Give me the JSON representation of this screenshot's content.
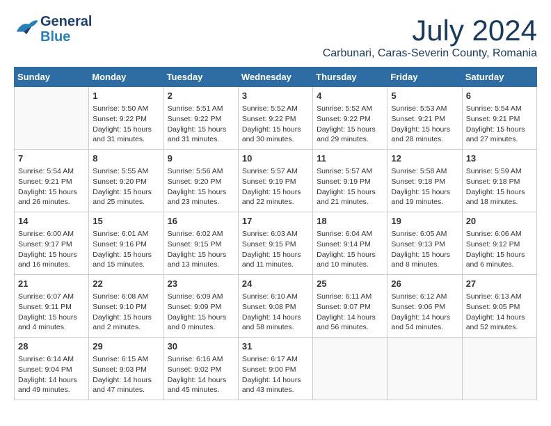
{
  "header": {
    "logo_general": "General",
    "logo_blue": "Blue",
    "month": "July 2024",
    "location": "Carbunari, Caras-Severin County, Romania"
  },
  "weekdays": [
    "Sunday",
    "Monday",
    "Tuesday",
    "Wednesday",
    "Thursday",
    "Friday",
    "Saturday"
  ],
  "weeks": [
    [
      {
        "day": "",
        "content": ""
      },
      {
        "day": "1",
        "content": "Sunrise: 5:50 AM\nSunset: 9:22 PM\nDaylight: 15 hours\nand 31 minutes."
      },
      {
        "day": "2",
        "content": "Sunrise: 5:51 AM\nSunset: 9:22 PM\nDaylight: 15 hours\nand 31 minutes."
      },
      {
        "day": "3",
        "content": "Sunrise: 5:52 AM\nSunset: 9:22 PM\nDaylight: 15 hours\nand 30 minutes."
      },
      {
        "day": "4",
        "content": "Sunrise: 5:52 AM\nSunset: 9:22 PM\nDaylight: 15 hours\nand 29 minutes."
      },
      {
        "day": "5",
        "content": "Sunrise: 5:53 AM\nSunset: 9:21 PM\nDaylight: 15 hours\nand 28 minutes."
      },
      {
        "day": "6",
        "content": "Sunrise: 5:54 AM\nSunset: 9:21 PM\nDaylight: 15 hours\nand 27 minutes."
      }
    ],
    [
      {
        "day": "7",
        "content": "Sunrise: 5:54 AM\nSunset: 9:21 PM\nDaylight: 15 hours\nand 26 minutes."
      },
      {
        "day": "8",
        "content": "Sunrise: 5:55 AM\nSunset: 9:20 PM\nDaylight: 15 hours\nand 25 minutes."
      },
      {
        "day": "9",
        "content": "Sunrise: 5:56 AM\nSunset: 9:20 PM\nDaylight: 15 hours\nand 23 minutes."
      },
      {
        "day": "10",
        "content": "Sunrise: 5:57 AM\nSunset: 9:19 PM\nDaylight: 15 hours\nand 22 minutes."
      },
      {
        "day": "11",
        "content": "Sunrise: 5:57 AM\nSunset: 9:19 PM\nDaylight: 15 hours\nand 21 minutes."
      },
      {
        "day": "12",
        "content": "Sunrise: 5:58 AM\nSunset: 9:18 PM\nDaylight: 15 hours\nand 19 minutes."
      },
      {
        "day": "13",
        "content": "Sunrise: 5:59 AM\nSunset: 9:18 PM\nDaylight: 15 hours\nand 18 minutes."
      }
    ],
    [
      {
        "day": "14",
        "content": "Sunrise: 6:00 AM\nSunset: 9:17 PM\nDaylight: 15 hours\nand 16 minutes."
      },
      {
        "day": "15",
        "content": "Sunrise: 6:01 AM\nSunset: 9:16 PM\nDaylight: 15 hours\nand 15 minutes."
      },
      {
        "day": "16",
        "content": "Sunrise: 6:02 AM\nSunset: 9:15 PM\nDaylight: 15 hours\nand 13 minutes."
      },
      {
        "day": "17",
        "content": "Sunrise: 6:03 AM\nSunset: 9:15 PM\nDaylight: 15 hours\nand 11 minutes."
      },
      {
        "day": "18",
        "content": "Sunrise: 6:04 AM\nSunset: 9:14 PM\nDaylight: 15 hours\nand 10 minutes."
      },
      {
        "day": "19",
        "content": "Sunrise: 6:05 AM\nSunset: 9:13 PM\nDaylight: 15 hours\nand 8 minutes."
      },
      {
        "day": "20",
        "content": "Sunrise: 6:06 AM\nSunset: 9:12 PM\nDaylight: 15 hours\nand 6 minutes."
      }
    ],
    [
      {
        "day": "21",
        "content": "Sunrise: 6:07 AM\nSunset: 9:11 PM\nDaylight: 15 hours\nand 4 minutes."
      },
      {
        "day": "22",
        "content": "Sunrise: 6:08 AM\nSunset: 9:10 PM\nDaylight: 15 hours\nand 2 minutes."
      },
      {
        "day": "23",
        "content": "Sunrise: 6:09 AM\nSunset: 9:09 PM\nDaylight: 15 hours\nand 0 minutes."
      },
      {
        "day": "24",
        "content": "Sunrise: 6:10 AM\nSunset: 9:08 PM\nDaylight: 14 hours\nand 58 minutes."
      },
      {
        "day": "25",
        "content": "Sunrise: 6:11 AM\nSunset: 9:07 PM\nDaylight: 14 hours\nand 56 minutes."
      },
      {
        "day": "26",
        "content": "Sunrise: 6:12 AM\nSunset: 9:06 PM\nDaylight: 14 hours\nand 54 minutes."
      },
      {
        "day": "27",
        "content": "Sunrise: 6:13 AM\nSunset: 9:05 PM\nDaylight: 14 hours\nand 52 minutes."
      }
    ],
    [
      {
        "day": "28",
        "content": "Sunrise: 6:14 AM\nSunset: 9:04 PM\nDaylight: 14 hours\nand 49 minutes."
      },
      {
        "day": "29",
        "content": "Sunrise: 6:15 AM\nSunset: 9:03 PM\nDaylight: 14 hours\nand 47 minutes."
      },
      {
        "day": "30",
        "content": "Sunrise: 6:16 AM\nSunset: 9:02 PM\nDaylight: 14 hours\nand 45 minutes."
      },
      {
        "day": "31",
        "content": "Sunrise: 6:17 AM\nSunset: 9:00 PM\nDaylight: 14 hours\nand 43 minutes."
      },
      {
        "day": "",
        "content": ""
      },
      {
        "day": "",
        "content": ""
      },
      {
        "day": "",
        "content": ""
      }
    ]
  ]
}
